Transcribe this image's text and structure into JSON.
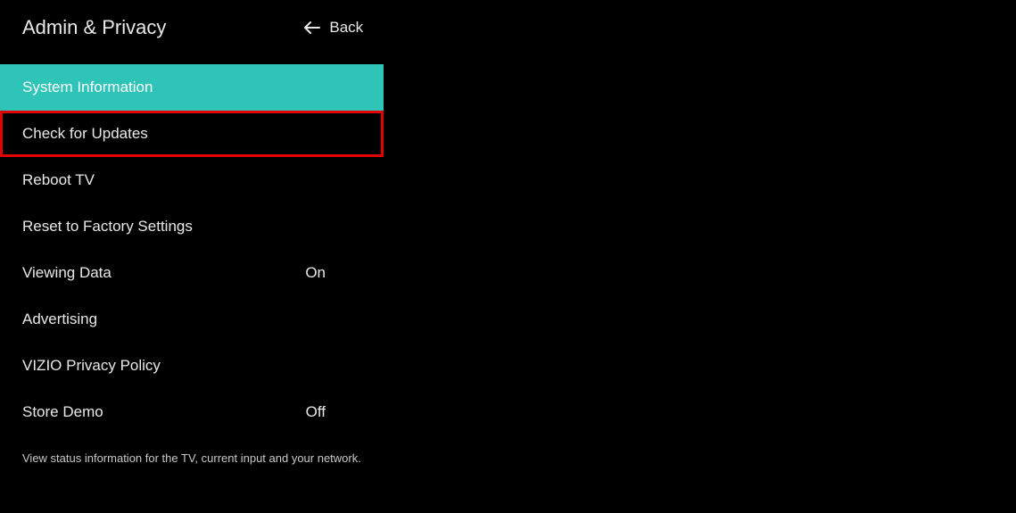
{
  "header": {
    "title": "Admin & Privacy",
    "back_label": "Back"
  },
  "menu": {
    "items": [
      {
        "label": "System Information",
        "value": "",
        "selected": true,
        "highlighted": false
      },
      {
        "label": "Check for Updates",
        "value": "",
        "selected": false,
        "highlighted": true
      },
      {
        "label": "Reboot TV",
        "value": "",
        "selected": false,
        "highlighted": false
      },
      {
        "label": "Reset to Factory Settings",
        "value": "",
        "selected": false,
        "highlighted": false
      },
      {
        "label": "Viewing Data",
        "value": "On",
        "selected": false,
        "highlighted": false
      },
      {
        "label": "Advertising",
        "value": "",
        "selected": false,
        "highlighted": false
      },
      {
        "label": "VIZIO Privacy Policy",
        "value": "",
        "selected": false,
        "highlighted": false
      },
      {
        "label": "Store Demo",
        "value": "Off",
        "selected": false,
        "highlighted": false
      }
    ]
  },
  "description": "View status information for the TV, current input and your network."
}
